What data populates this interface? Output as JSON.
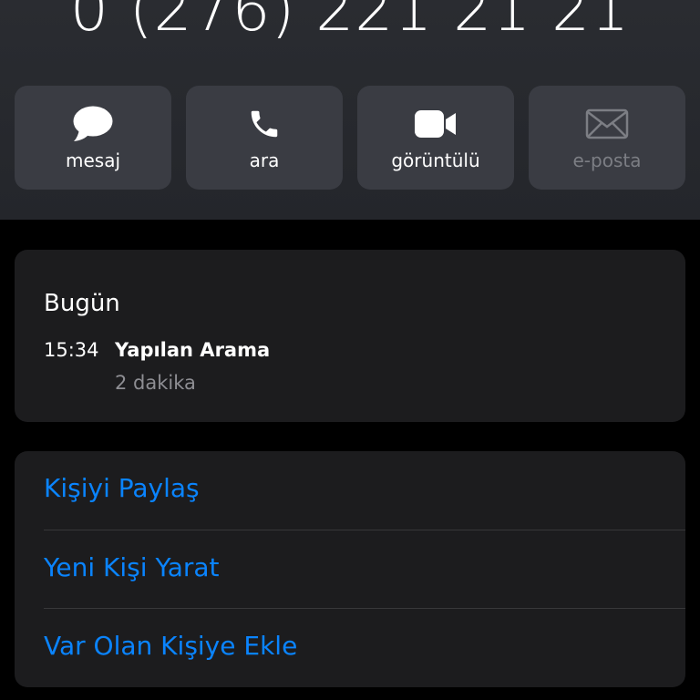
{
  "contact": {
    "phone_number": "0 (276) 221 21 21"
  },
  "actions": [
    {
      "label": "mesaj",
      "icon": "message-bubble-icon",
      "enabled": true
    },
    {
      "label": "ara",
      "icon": "phone-icon",
      "enabled": true
    },
    {
      "label": "görüntülü",
      "icon": "video-camera-icon",
      "enabled": true
    },
    {
      "label": "e-posta",
      "icon": "envelope-icon",
      "enabled": false
    }
  ],
  "recents": {
    "day": "Bugün",
    "calls": [
      {
        "time": "15:34",
        "type": "Yapılan Arama",
        "duration": "2 dakika"
      }
    ]
  },
  "options": [
    {
      "label": "Kişiyi Paylaş"
    },
    {
      "label": "Yeni Kişi Yarat"
    },
    {
      "label": "Var Olan Kişiye Ekle"
    }
  ],
  "colors": {
    "accent": "#0a84ff",
    "background": "#000000",
    "card": "#1c1c1e",
    "button": "#3a3c43",
    "disabled_text": "#7c7e84",
    "secondary_text": "#8e8e93"
  }
}
